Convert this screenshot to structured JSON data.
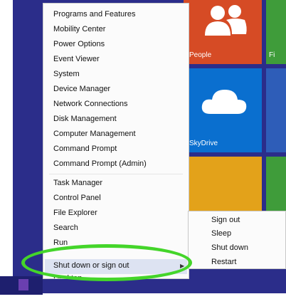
{
  "menu": {
    "items": [
      "Programs and Features",
      "Mobility Center",
      "Power Options",
      "Event Viewer",
      "System",
      "Device Manager",
      "Network Connections",
      "Disk Management",
      "Computer Management",
      "Command Prompt",
      "Command Prompt (Admin)",
      "Task Manager",
      "Control Panel",
      "File Explorer",
      "Search",
      "Run",
      "Shut down or sign out",
      "Desktop"
    ]
  },
  "submenu": {
    "items": [
      "Sign out",
      "Sleep",
      "Shut down",
      "Restart"
    ]
  },
  "tiles": {
    "people": "People",
    "skydrive": "SkyDrive",
    "fi": "Fi"
  },
  "colors": {
    "highlight_ring": "#44d52a",
    "desktop_bg": "#2b2d8a"
  }
}
